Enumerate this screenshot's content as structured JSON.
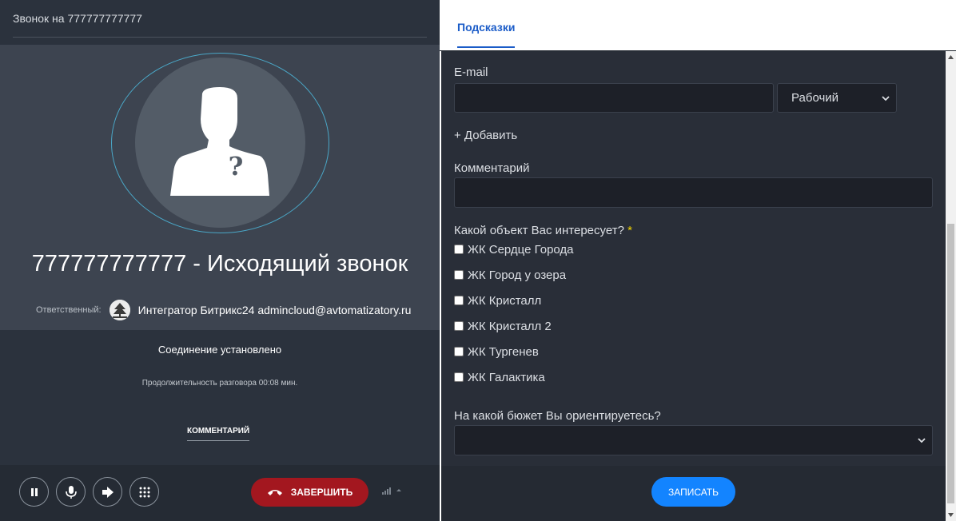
{
  "call": {
    "title": "Звонок на 777777777777",
    "caller_heading": "777777777777 - Исходящий звонок",
    "responsible_label": "Ответственный:",
    "responsible_name": "Интегратор Битрикс24 admincloud@avtomatizatory.ru",
    "status": "Соединение установлено",
    "duration": "Продолжительность разговора 00:08 мин.",
    "comment_link": "КОММЕНТАРИЙ",
    "hangup_label": "ЗАВЕРШИТЬ",
    "controls": [
      "pause-icon",
      "microphone-icon",
      "transfer-icon",
      "keypad-icon"
    ]
  },
  "form": {
    "tab": "Подсказки",
    "email_label": "E-mail",
    "email_value": "",
    "email_type": "Рабочий",
    "add_label": "+ Добавить",
    "comment_label": "Комментарий",
    "comment_value": "",
    "object_question": "Какой объект Вас интересует?",
    "required_mark": "*",
    "objects": [
      "ЖК Сердце Города",
      "ЖК Город у озера",
      "ЖК Кристалл",
      "ЖК Кристалл 2",
      "ЖК Тургенев",
      "ЖК Галактика"
    ],
    "budget_question": "На какой бюжет Вы ориентируетесь?",
    "budget_value": "",
    "submit_label": "ЗАПИСАТЬ"
  },
  "colors": {
    "accent": "#1384ff",
    "tab_active": "#1b5cc8",
    "hangup": "#a3171f",
    "required": "#f2d300"
  }
}
